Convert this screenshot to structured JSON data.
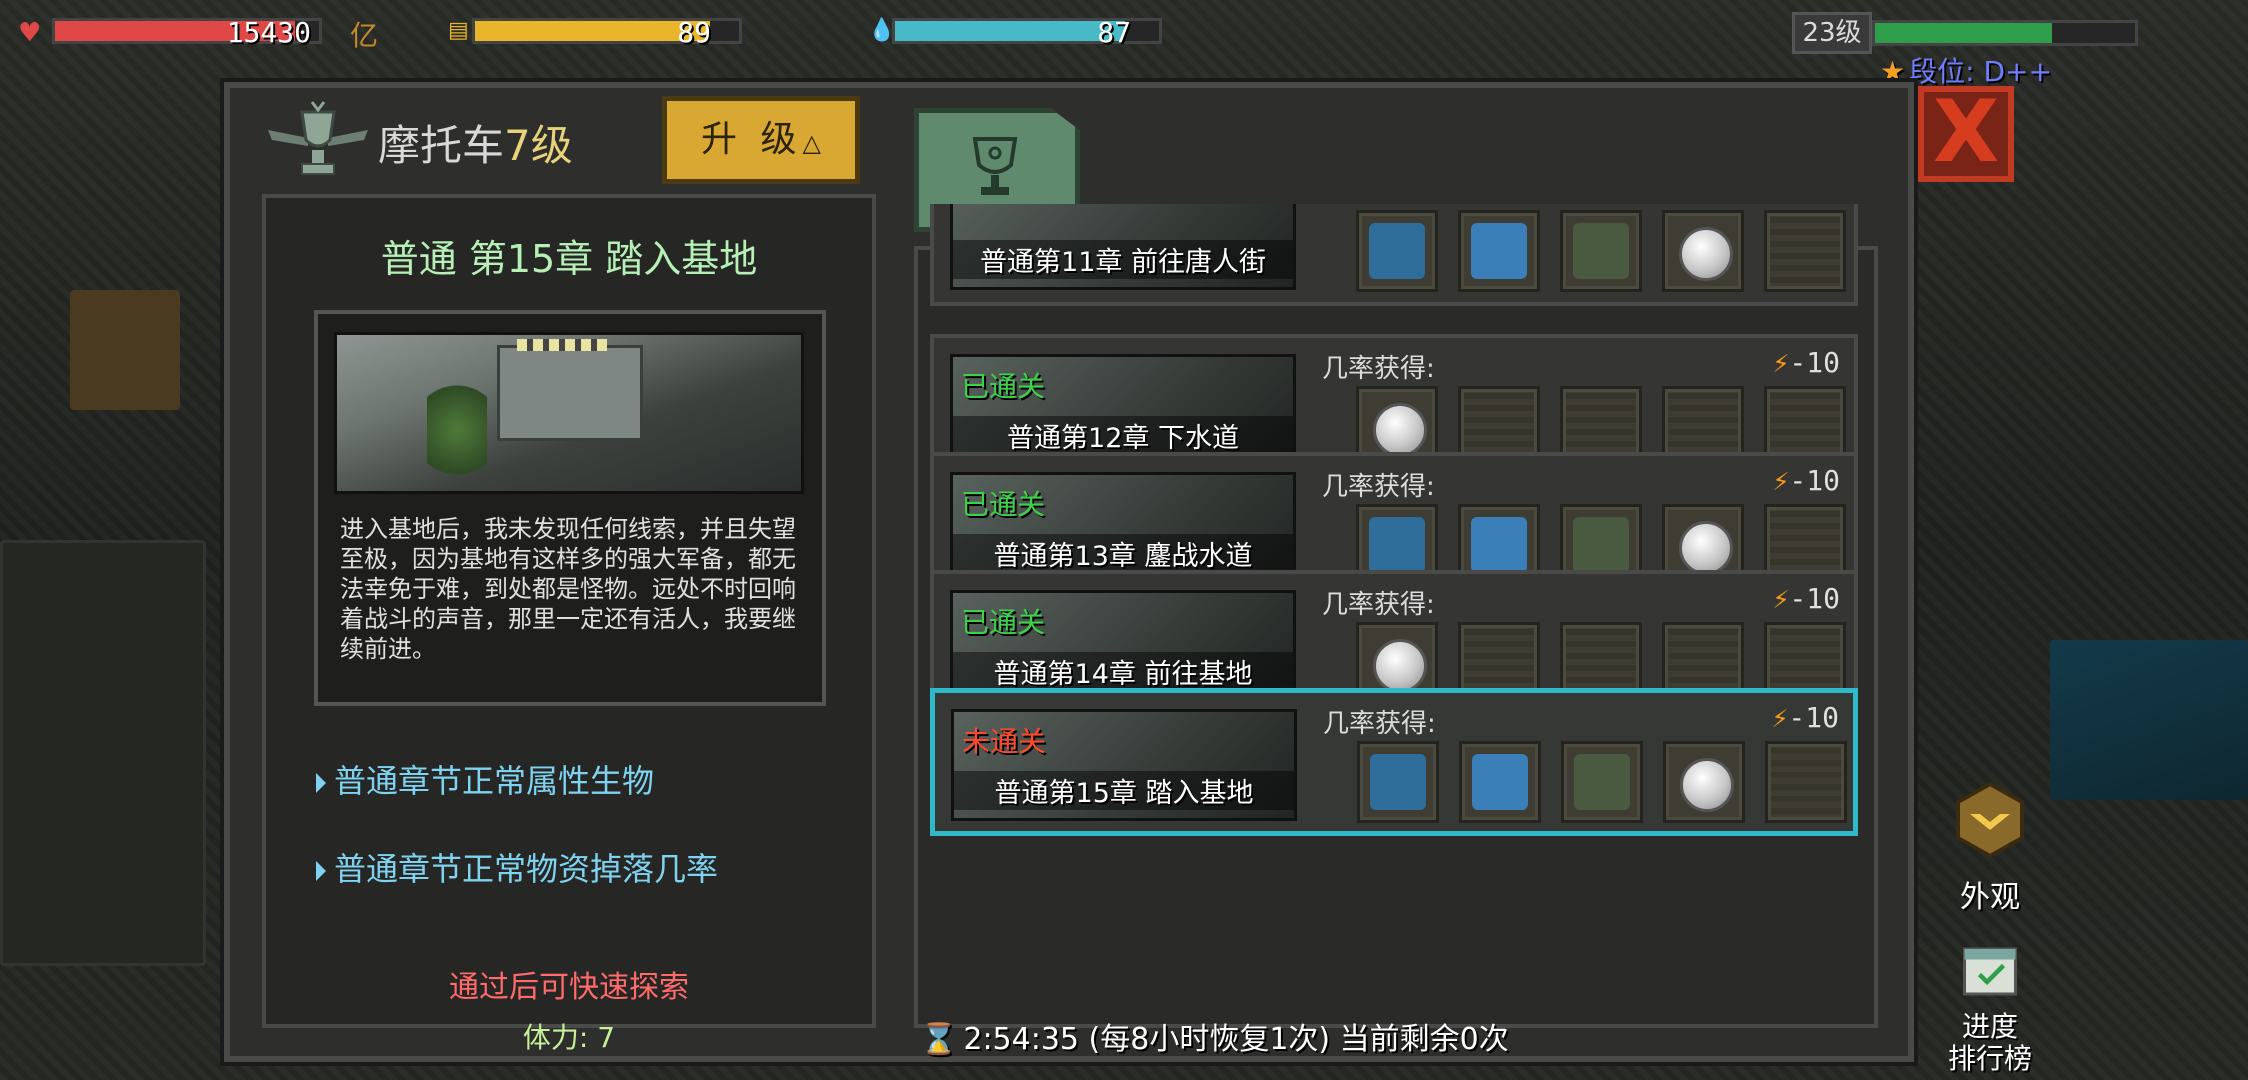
{
  "hud": {
    "health_value": "15430",
    "health_fill": 0.91,
    "gold_tag": "亿",
    "food_value": "89",
    "food_fill": 0.89,
    "water_value": "87",
    "water_fill": 0.87,
    "level_label": "23级",
    "exp_fill": 0.68,
    "rank_label": "段位: D++"
  },
  "header": {
    "title_prefix": "摩托车",
    "title_level": "7级",
    "upgrade_label": "升 级",
    "close_symbol": "X"
  },
  "detail": {
    "title": "普通 第15章 踏入基地",
    "description": "进入基地后，我未发现任何线索，并且失望至极，因为基地有这样多的强大军备，都无法幸免于难，到处都是怪物。远处不时回响着战斗的声音，那里一定还有活人，我要继续前进。",
    "link_creatures": "普通章节正常属性生物",
    "link_drops": "普通章节正常物资掉落几率",
    "quick_explore": "通过后可快速探索",
    "stamina": "体力: 7"
  },
  "chapters": [
    {
      "name": "普通第11章 前往唐人街",
      "status": "",
      "prob_label": "",
      "cost": "",
      "items": [
        "ammo-crate",
        "gun-case",
        "bullets",
        "coin",
        "empty"
      ]
    },
    {
      "name": "普通第12章 下水道",
      "status": "已通关",
      "prob_label": "几率获得:",
      "cost": "-10",
      "items": [
        "coin",
        "empty",
        "empty",
        "empty",
        "empty"
      ]
    },
    {
      "name": "普通第13章 鏖战水道",
      "status": "已通关",
      "prob_label": "几率获得:",
      "cost": "-10",
      "items": [
        "ammo-crate",
        "gun-case",
        "bullets",
        "coin",
        "empty"
      ]
    },
    {
      "name": "普通第14章 前往基地",
      "status": "已通关",
      "prob_label": "几率获得:",
      "cost": "-10",
      "items": [
        "coin",
        "empty",
        "empty",
        "empty",
        "empty"
      ]
    },
    {
      "name": "普通第15章 踏入基地",
      "status": "未通关",
      "prob_label": "几率获得:",
      "cost": "-10",
      "items": [
        "ammo-crate",
        "gun-case",
        "bullets",
        "coin",
        "empty"
      ]
    }
  ],
  "footer": {
    "timer": "2:54:35 (每8小时恢复1次) 当前剩余0次"
  },
  "side": {
    "appearance_label": "外观",
    "leaderboard_label": "进度\n排行榜"
  },
  "colors": {
    "health": "#e04848",
    "food": "#e9b52b",
    "water": "#48b9c6",
    "exp": "#2f9e4a",
    "selected_border": "#2fb9c9",
    "cleared": "#3ed24a",
    "not_cleared": "#ff4a2a"
  }
}
